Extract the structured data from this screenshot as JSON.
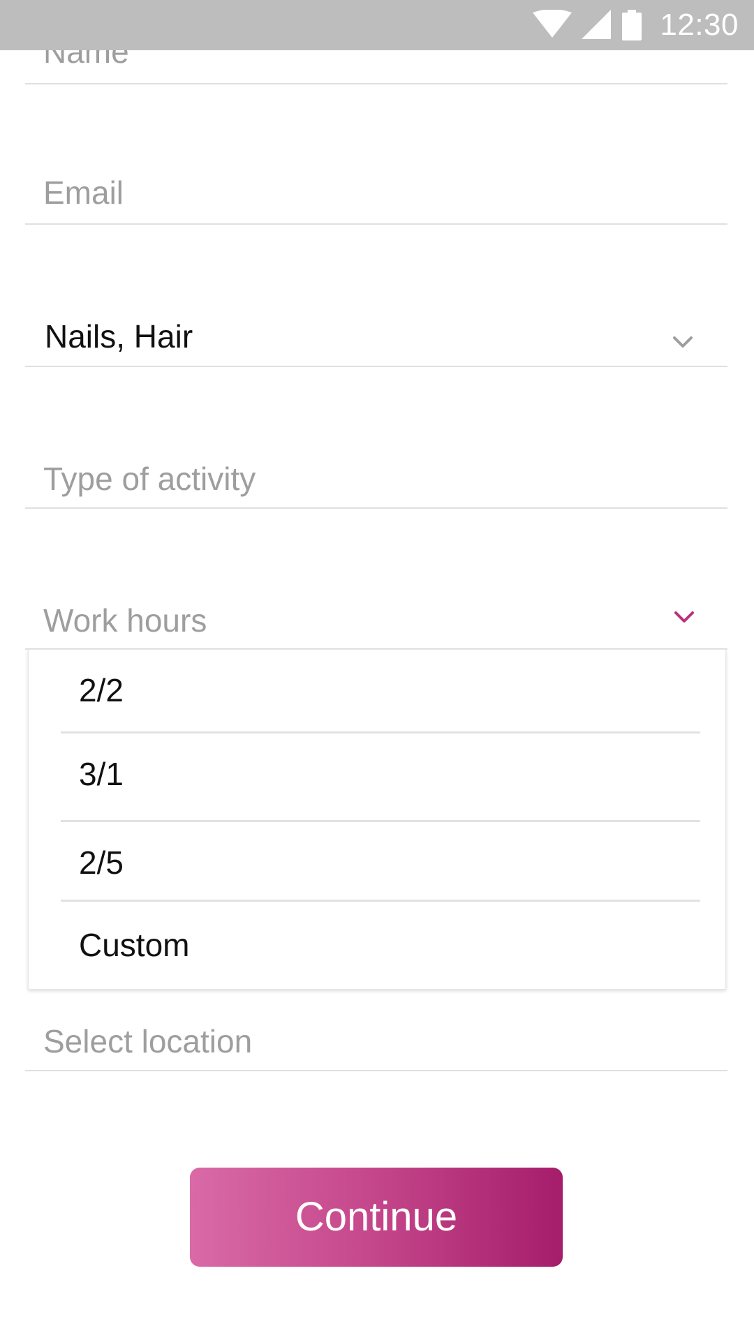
{
  "status_bar": {
    "time": "12:30",
    "icons": [
      "wifi-icon",
      "cellular-signal-icon",
      "battery-icon"
    ]
  },
  "form": {
    "name": {
      "placeholder": "Name",
      "value": ""
    },
    "email": {
      "placeholder": "Email",
      "value": ""
    },
    "categories": {
      "value": "Nails, Hair",
      "icon": "chevron-down-icon"
    },
    "activity_type": {
      "placeholder": "Type of activity",
      "value": ""
    },
    "work_hours": {
      "placeholder": "Work hours",
      "value": "",
      "icon": "chevron-down-icon",
      "expanded": true,
      "options": [
        "2/2",
        "3/1",
        "2/5",
        "Custom"
      ]
    },
    "location": {
      "placeholder": "Select location",
      "value": ""
    }
  },
  "continue_button": {
    "label": "Continue"
  },
  "colors": {
    "accent": "#b8327d",
    "button_gradient_start": "#d96aa7",
    "button_gradient_end": "#a51d6b",
    "status_bar": "#bdbdbd",
    "placeholder_text": "#9e9e9e",
    "divider": "#e0e0e0"
  }
}
